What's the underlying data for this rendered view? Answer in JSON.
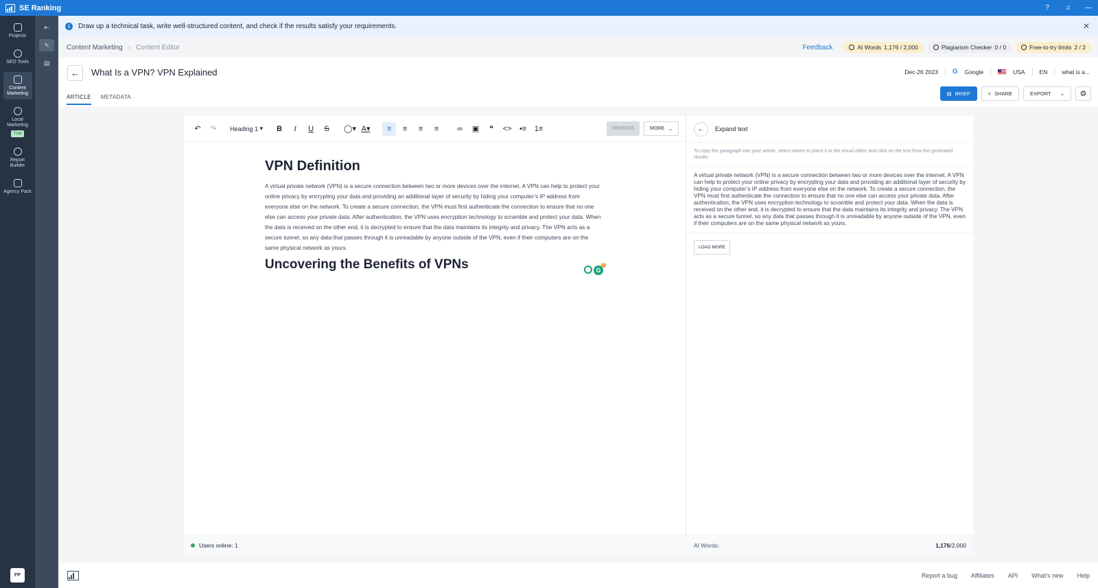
{
  "app": {
    "name": "SE Ranking"
  },
  "nav": {
    "items": [
      {
        "label": "Projects"
      },
      {
        "label": "SEO Tools"
      },
      {
        "label": "Content Marketing"
      },
      {
        "label": "Local Marketing",
        "badge": "Trial"
      },
      {
        "label": "Report Builder"
      },
      {
        "label": "Agency Pack"
      }
    ],
    "avatar": "FP"
  },
  "banner": {
    "text": "Draw up a technical task, write well-structured content, and check if the results satisfy your requirements."
  },
  "breadcrumb": {
    "root": "Content Marketing",
    "current": "Content Editor"
  },
  "header_right": {
    "feedback": "Feedback",
    "ai_words_label": "AI Words",
    "ai_words_value": "1,176 / 2,000",
    "plagiarism_label": "Plagiarism Checker",
    "plagiarism_value": "0 / 0",
    "free_label": "Free-to-try limits",
    "free_value": "2 / 2"
  },
  "document": {
    "title": "What Is a VPN? VPN Explained",
    "date": "Dec-26 2023",
    "engine": "Google",
    "country": "USA",
    "language": "EN",
    "keyword": "what is a..."
  },
  "tabs": [
    {
      "label": "ARTICLE"
    },
    {
      "label": "METADATA"
    }
  ],
  "actions": {
    "brief": "BRIEF",
    "share": "SHARE",
    "export": "EXPORT"
  },
  "toolbar": {
    "heading": "Heading 1",
    "rewrite": "REWRITE",
    "more": "MORE"
  },
  "article": {
    "h1": "VPN Definition",
    "paragraph": "A virtual private network (VPN) is a secure connection between two or more devices over the internet. A VPN can help to protect your online privacy by encrypting your data and providing an additional layer of security by hiding your computer’s IP address from everyone else on the network. To create a secure connection, the VPN must first authenticate the connection to ensure that no one else can access your private data. After authentication, the VPN uses encryption technology to scramble and protect your data. When the data is received on the other end, it is decrypted to ensure that the data maintains its integrity and privacy. The VPN acts as a secure tunnel, so any data that passes through it is unreadable by anyone outside of the VPN, even if their computers are on the same physical network as yours.",
    "h2": "Uncovering the Benefits of VPNs",
    "users_online": "Users online: 1"
  },
  "panel": {
    "title": "Expand text",
    "hint": "To copy the paragraph into your article, select where to place it in the visual editor and click on the text from the generated results.",
    "result": "A virtual private network (VPN) is a secure connection between two or more devices over the internet. A VPN can help to protect your online privacy by encrypting your data and providing an additional layer of security by hiding your computer’s IP address from everyone else on the network. To create a secure connection, the VPN must first authenticate the connection to ensure that no one else can access your private data. After authentication, the VPN uses encryption technology to scramble and protect your data. When the data is received on the other end, it is decrypted to ensure that the data maintains its integrity and privacy. The VPN acts as a secure tunnel, so any data that passes through it is unreadable by anyone outside of the VPN, even if their computers are on the same physical network as yours.",
    "load_more": "LOAD MORE",
    "ai_words_label": "AI Words:",
    "ai_words_used": "1,176",
    "ai_words_total": "/2,000"
  },
  "footer": {
    "links": [
      "Report a bug",
      "Affiliates",
      "API",
      "What's new",
      "Help"
    ]
  },
  "colors": {
    "brand": "#1e78d6",
    "nav_bg": "#253343",
    "success": "#2ea66a"
  }
}
